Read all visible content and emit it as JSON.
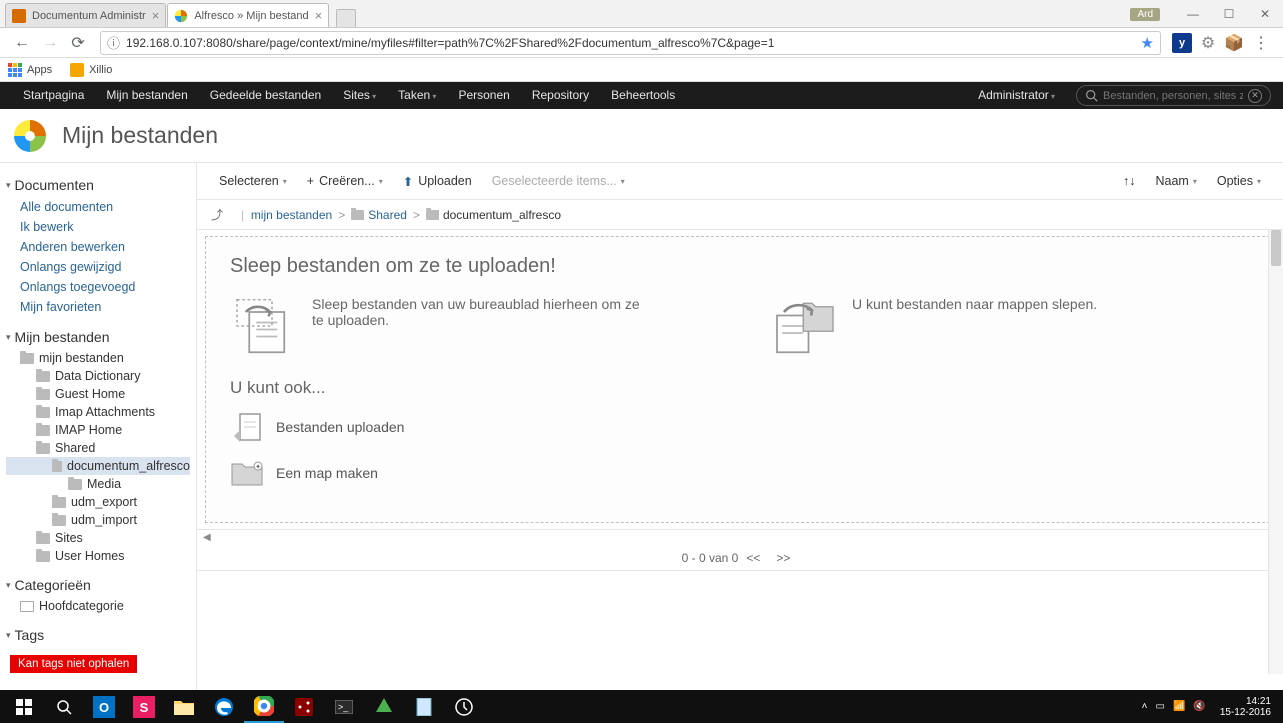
{
  "browser": {
    "tabs": [
      {
        "title": "Documentum Administr",
        "active": false
      },
      {
        "title": "Alfresco » Mijn bestand",
        "active": true
      }
    ],
    "userBadge": "Ard",
    "url": "192.168.0.107:8080/share/page/context/mine/myfiles#filter=path%7C%2FShared%2Fdocumentum_alfresco%7C&page=1"
  },
  "bookmarks": {
    "apps": "Apps",
    "items": [
      "Xillio"
    ]
  },
  "nav": {
    "items": [
      "Startpagina",
      "Mijn bestanden",
      "Gedeelde bestanden",
      "Sites",
      "Taken",
      "Personen",
      "Repository",
      "Beheertools"
    ],
    "dropdowns": [
      false,
      false,
      false,
      true,
      true,
      false,
      false,
      false
    ],
    "user": "Administrator",
    "searchPlaceholder": "Bestanden, personen, sites zo"
  },
  "pageTitle": "Mijn bestanden",
  "sidebar": {
    "sections": {
      "documents": {
        "title": "Documenten",
        "links": [
          "Alle documenten",
          "Ik bewerk",
          "Anderen bewerken",
          "Onlangs gewijzigd",
          "Onlangs toegevoegd",
          "Mijn favorieten"
        ]
      },
      "myfiles": {
        "title": "Mijn bestanden",
        "tree": [
          {
            "label": "mijn bestanden",
            "lvl": 1
          },
          {
            "label": "Data Dictionary",
            "lvl": 2
          },
          {
            "label": "Guest Home",
            "lvl": 2
          },
          {
            "label": "Imap Attachments",
            "lvl": 2
          },
          {
            "label": "IMAP Home",
            "lvl": 2
          },
          {
            "label": "Shared",
            "lvl": 2
          },
          {
            "label": "documentum_alfresco",
            "lvl": 3,
            "selected": true
          },
          {
            "label": "Media",
            "lvl": 4
          },
          {
            "label": "udm_export",
            "lvl": 3
          },
          {
            "label": "udm_import",
            "lvl": 3
          },
          {
            "label": "Sites",
            "lvl": 2
          },
          {
            "label": "User Homes",
            "lvl": 2
          }
        ]
      },
      "categories": {
        "title": "Categorieën",
        "items": [
          "Hoofdcategorie"
        ]
      },
      "tags": {
        "title": "Tags"
      }
    }
  },
  "toolbar": {
    "select": "Selecteren",
    "create": "Creëren...",
    "upload": "Uploaden",
    "selected": "Geselecteerde items...",
    "name": "Naam",
    "options": "Opties"
  },
  "breadcrumb": {
    "items": [
      "mijn bestanden",
      "Shared",
      "documentum_alfresco"
    ]
  },
  "dropzone": {
    "title": "Sleep bestanden om ze te uploaden!",
    "desc1": "Sleep bestanden van uw bureaublad hierheen om ze te uploaden.",
    "desc2": "U kunt bestanden naar mappen slepen.",
    "subtitle": "U kunt ook...",
    "action1": "Bestanden uploaden",
    "action2": "Een map maken"
  },
  "pager": {
    "text": "0 - 0 van 0",
    "prev": "<<",
    "next": ">>"
  },
  "error": "Kan tags niet ophalen",
  "systray": {
    "time": "14:21",
    "date": "15-12-2016"
  }
}
